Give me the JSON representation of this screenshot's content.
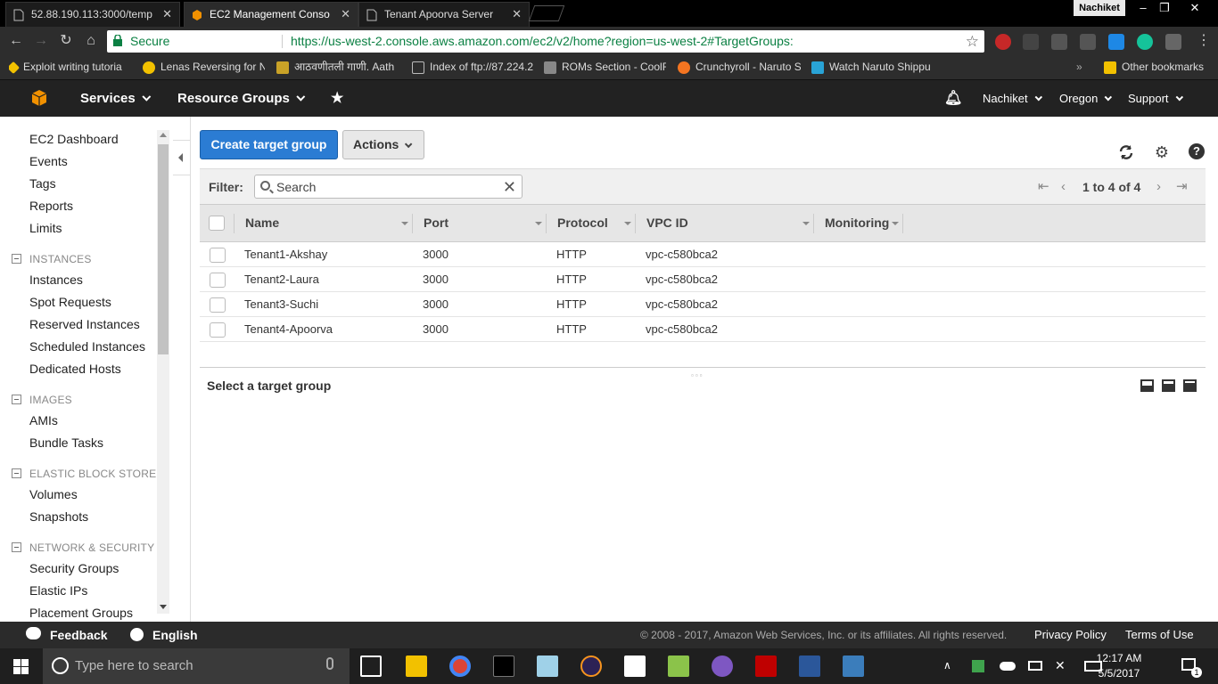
{
  "browser": {
    "tabs": [
      {
        "label": "52.88.190.113:3000/temp",
        "active": false
      },
      {
        "label": "EC2 Management Conso",
        "active": true
      },
      {
        "label": "Tenant Apoorva Server",
        "active": false
      }
    ],
    "profile_name": "Nachiket",
    "secure_label": "Secure",
    "url": "https://us-west-2.console.aws.amazon.com/ec2/v2/home?region=us-west-2#TargetGroups:",
    "bookmarks": [
      "Exploit writing tutoria",
      "Lenas Reversing for N",
      "आठवणीतली गाणी. Aath",
      "Index of ftp://87.224.2",
      "ROMs Section - CoolR",
      "Crunchyroll - Naruto S",
      "Watch Naruto Shippu"
    ],
    "other_bookmarks": "Other bookmarks",
    "more_glyph": "»"
  },
  "aws_header": {
    "services": "Services",
    "resource_groups": "Resource Groups",
    "user": "Nachiket",
    "region": "Oregon",
    "support": "Support"
  },
  "sidebar": {
    "top_items": [
      "EC2 Dashboard",
      "Events",
      "Tags",
      "Reports",
      "Limits"
    ],
    "sections": [
      {
        "title": "INSTANCES",
        "items": [
          "Instances",
          "Spot Requests",
          "Reserved Instances",
          "Scheduled Instances",
          "Dedicated Hosts"
        ]
      },
      {
        "title": "IMAGES",
        "items": [
          "AMIs",
          "Bundle Tasks"
        ]
      },
      {
        "title": "ELASTIC BLOCK STORE",
        "items": [
          "Volumes",
          "Snapshots"
        ]
      },
      {
        "title": "NETWORK & SECURITY",
        "items": [
          "Security Groups",
          "Elastic IPs",
          "Placement Groups"
        ]
      }
    ]
  },
  "main": {
    "create_button": "Create target group",
    "actions_button": "Actions",
    "filter_label": "Filter:",
    "search_placeholder": "Search",
    "pagination": "1 to 4 of 4",
    "columns": [
      "Name",
      "Port",
      "Protocol",
      "VPC ID",
      "Monitoring"
    ],
    "rows": [
      {
        "name": "Tenant1-Akshay",
        "port": "3000",
        "protocol": "HTTP",
        "vpc": "vpc-c580bca2"
      },
      {
        "name": "Tenant2-Laura",
        "port": "3000",
        "protocol": "HTTP",
        "vpc": "vpc-c580bca2"
      },
      {
        "name": "Tenant3-Suchi",
        "port": "3000",
        "protocol": "HTTP",
        "vpc": "vpc-c580bca2"
      },
      {
        "name": "Tenant4-Apoorva",
        "port": "3000",
        "protocol": "HTTP",
        "vpc": "vpc-c580bca2"
      }
    ],
    "detail_title": "Select a target group"
  },
  "footer": {
    "feedback": "Feedback",
    "language": "English",
    "copyright": "© 2008 - 2017, Amazon Web Services, Inc. or its affiliates. All rights reserved.",
    "privacy": "Privacy Policy",
    "terms": "Terms of Use"
  },
  "taskbar": {
    "search_placeholder": "Type here to search",
    "time": "12:17 AM",
    "date": "5/5/2017",
    "notification_count": "1"
  },
  "colors": {
    "aws_header": "#222222",
    "primary_button": "#2b7cd3",
    "secure_green": "#0b8043",
    "aws_orange": "#f29100"
  }
}
